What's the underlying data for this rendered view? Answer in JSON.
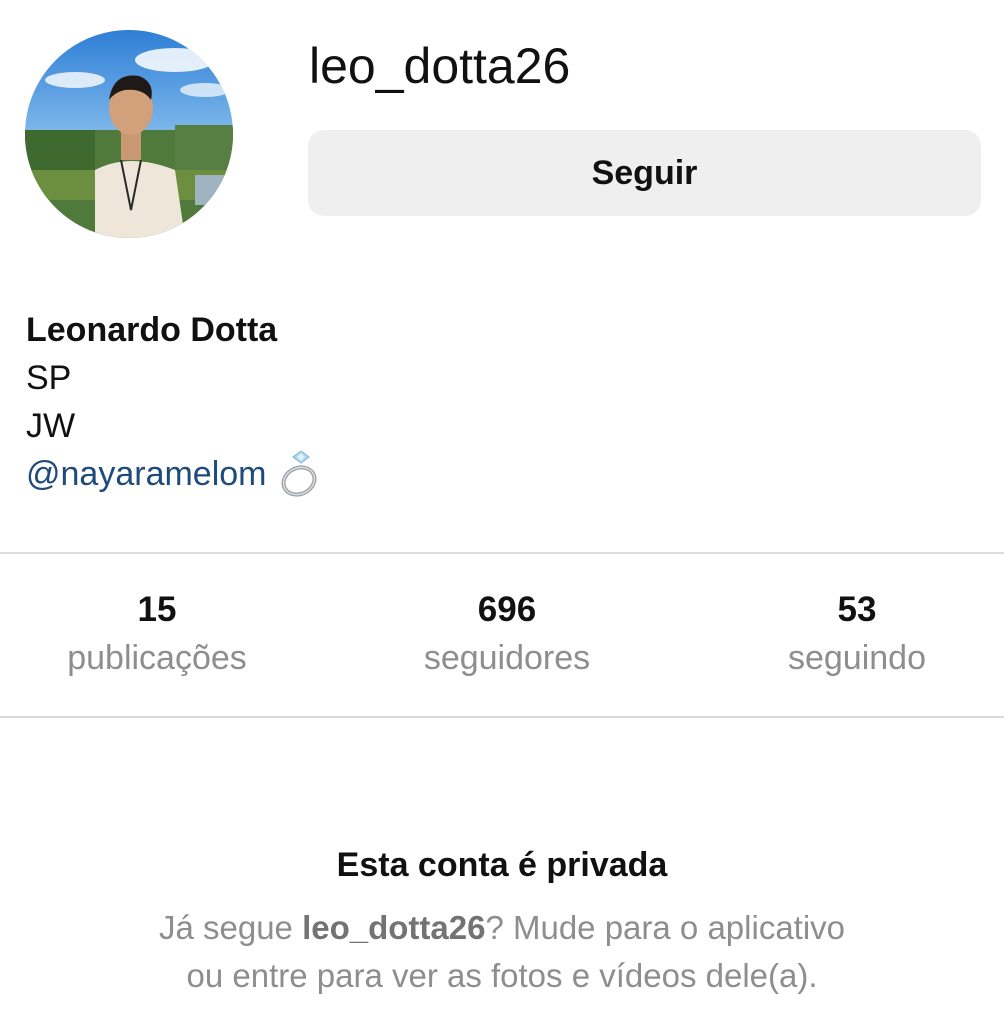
{
  "profile": {
    "username": "leo_dotta26",
    "avatar_icon": "profile-photo",
    "follow_label": "Seguir",
    "full_name": "Leonardo Dotta",
    "bio_lines": [
      "SP",
      "JW"
    ],
    "bio_mention": "@nayaramelom",
    "bio_emoji_icon": "ring-icon"
  },
  "stats": {
    "posts_count": "15",
    "posts_label": "publicações",
    "followers_count": "696",
    "followers_label": "seguidores",
    "following_count": "53",
    "following_label": "seguindo"
  },
  "private_notice": {
    "title": "Esta conta é privada",
    "text_prefix": "Já segue ",
    "text_username": "leo_dotta26",
    "text_suffix": "? Mude para o aplicativo",
    "text_line2": "ou entre para ver as fotos e vídeos dele(a)."
  },
  "colors": {
    "mention": "#1e4b7a",
    "button_bg": "#efefef",
    "secondary_text": "#8e8e8e",
    "divider": "#dbdbdb"
  }
}
